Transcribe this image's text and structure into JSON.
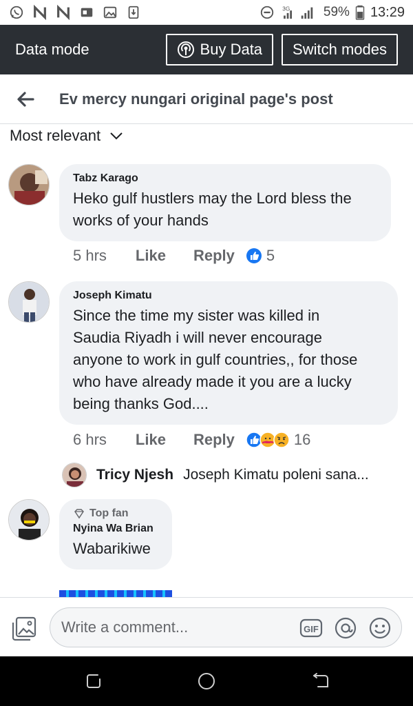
{
  "status_bar": {
    "network": "3G",
    "battery": "59%",
    "time": "13:29"
  },
  "mode_bar": {
    "label": "Data mode",
    "buy_data": "Buy Data",
    "switch_modes": "Switch modes"
  },
  "header": {
    "title": "Ev mercy nungari original page's post"
  },
  "sort": {
    "label": "Most relevant"
  },
  "comments": [
    {
      "name": "Tabz Karago",
      "text_lines": [
        "Heko gulf hustlers may the Lord bless the",
        "works of your hands"
      ],
      "time": "5 hrs",
      "like": "Like",
      "reply": "Reply",
      "reaction_count": "5"
    },
    {
      "name": "Joseph Kimatu",
      "text_lines": [
        "Since the time my sister was killed in",
        "Saudia Riyadh i will never encourage",
        "anyone to work in gulf countries,, for those",
        "who have already made it you are a lucky",
        "being thanks God...."
      ],
      "time": "6 hrs",
      "like": "Like",
      "reply": "Reply",
      "reaction_count": "16",
      "reply_preview": {
        "name": "Tricy Njesh",
        "text": "Joseph Kimatu poleni sana..."
      }
    },
    {
      "badge": "Top fan",
      "name": "Nyina Wa Brian",
      "text_lines": [
        "Wabarikiwe"
      ]
    }
  ],
  "composer": {
    "placeholder": "Write a comment..."
  },
  "colors": {
    "mode_bar_bg": "#2b2f34",
    "bubble_bg": "#f0f2f5",
    "like_blue": "#1877f2"
  }
}
